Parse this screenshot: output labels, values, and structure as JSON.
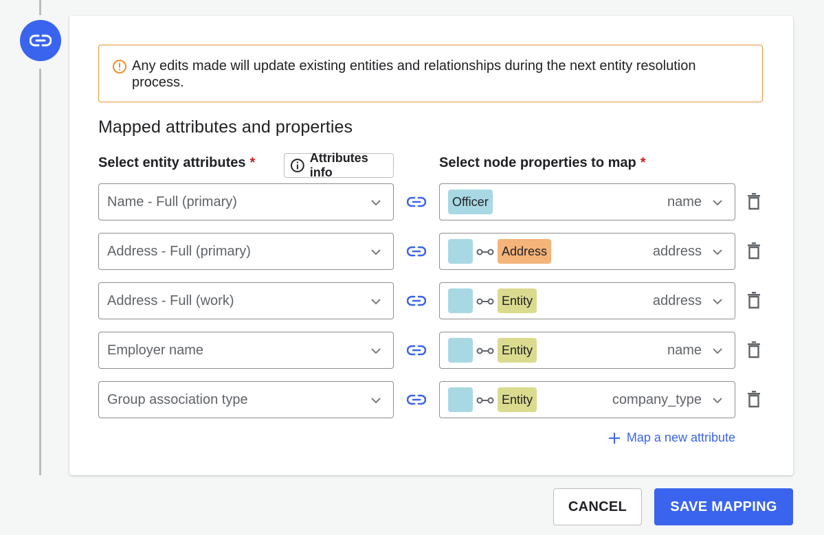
{
  "alert": {
    "text": "Any edits made will update existing entities and relationships during the next entity resolution process."
  },
  "section": {
    "title": "Mapped attributes and properties",
    "left_label": "Select entity attributes",
    "right_label": "Select node properties to map",
    "required_mark": "*",
    "info_button": "Attributes info"
  },
  "mappings": [
    {
      "attribute": "Name - Full (primary)",
      "chips": [
        {
          "label": "Officer",
          "color": "#a8d8e4"
        }
      ],
      "related": false,
      "property": "name"
    },
    {
      "attribute": "Address - Full (primary)",
      "related": true,
      "target_chip": {
        "label": "Address",
        "color": "#f4b47a"
      },
      "property": "address"
    },
    {
      "attribute": "Address - Full (work)",
      "related": true,
      "target_chip": {
        "label": "Entity",
        "color": "#dadb8e"
      },
      "property": "address"
    },
    {
      "attribute": "Employer name",
      "related": true,
      "target_chip": {
        "label": "Entity",
        "color": "#dadb8e"
      },
      "property": "name"
    },
    {
      "attribute": "Group association type",
      "related": true,
      "target_chip": {
        "label": "Entity",
        "color": "#dadb8e"
      },
      "property": "company_type"
    }
  ],
  "map_new_label": "Map a new attribute",
  "footer": {
    "cancel_label": "CANCEL",
    "save_label": "SAVE MAPPING"
  },
  "colors": {
    "accent": "#3a64ee",
    "warning": "#e8912d",
    "required": "#c5221f"
  }
}
